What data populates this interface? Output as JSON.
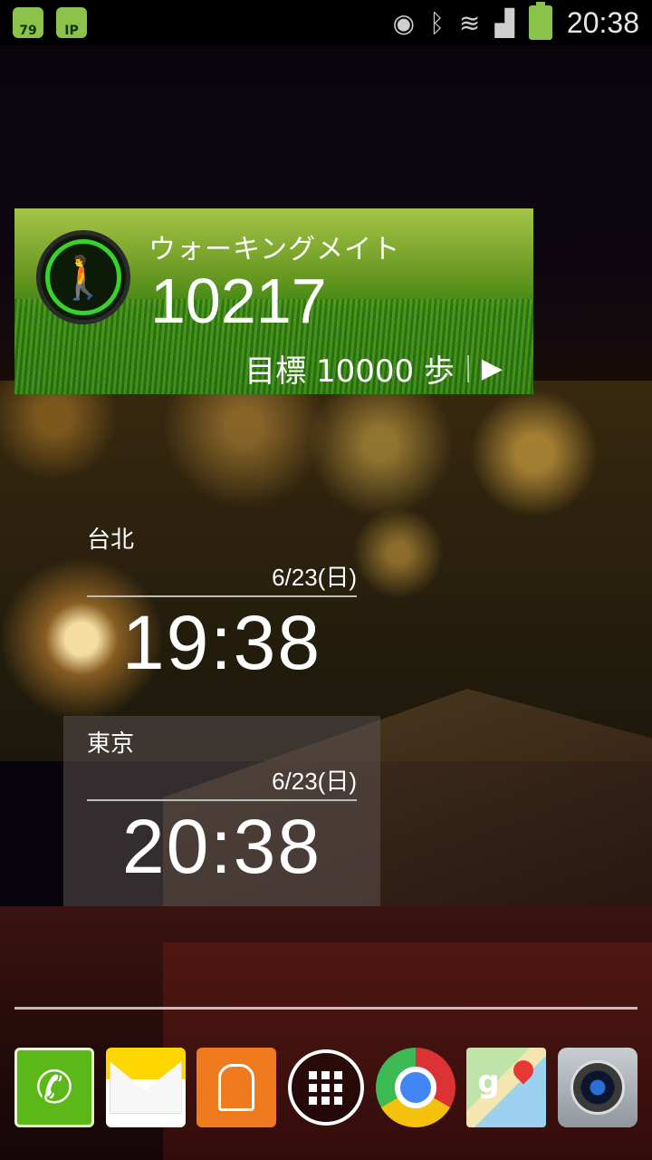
{
  "status_bar": {
    "notifications": [
      {
        "icon": "android-badge-icon",
        "text": "79"
      },
      {
        "icon": "phone-ip-icon",
        "text": "IP"
      }
    ],
    "indicators": [
      "eye-icon",
      "bluetooth-icon",
      "wifi-icon",
      "signal-icon",
      "battery-icon"
    ],
    "time": "20:38"
  },
  "walking_widget": {
    "title": "ウォーキングメイト",
    "steps": "10217",
    "goal_label": "目標 10000 歩",
    "accent_color": "#39d12b"
  },
  "world_clocks": [
    {
      "city": "台北",
      "date": "6/23(日)",
      "time": "19:38"
    },
    {
      "city": "東京",
      "date": "6/23(日)",
      "time": "20:38"
    }
  ],
  "dock": {
    "apps": [
      {
        "name": "phone",
        "icon": "phone-icon"
      },
      {
        "name": "messages",
        "icon": "envelope-icon"
      },
      {
        "name": "contacts",
        "icon": "person-icon"
      },
      {
        "name": "apps",
        "icon": "app-grid-icon"
      },
      {
        "name": "chrome",
        "icon": "chrome-icon"
      },
      {
        "name": "maps",
        "icon": "maps-icon"
      },
      {
        "name": "camera",
        "icon": "camera-icon"
      }
    ]
  }
}
